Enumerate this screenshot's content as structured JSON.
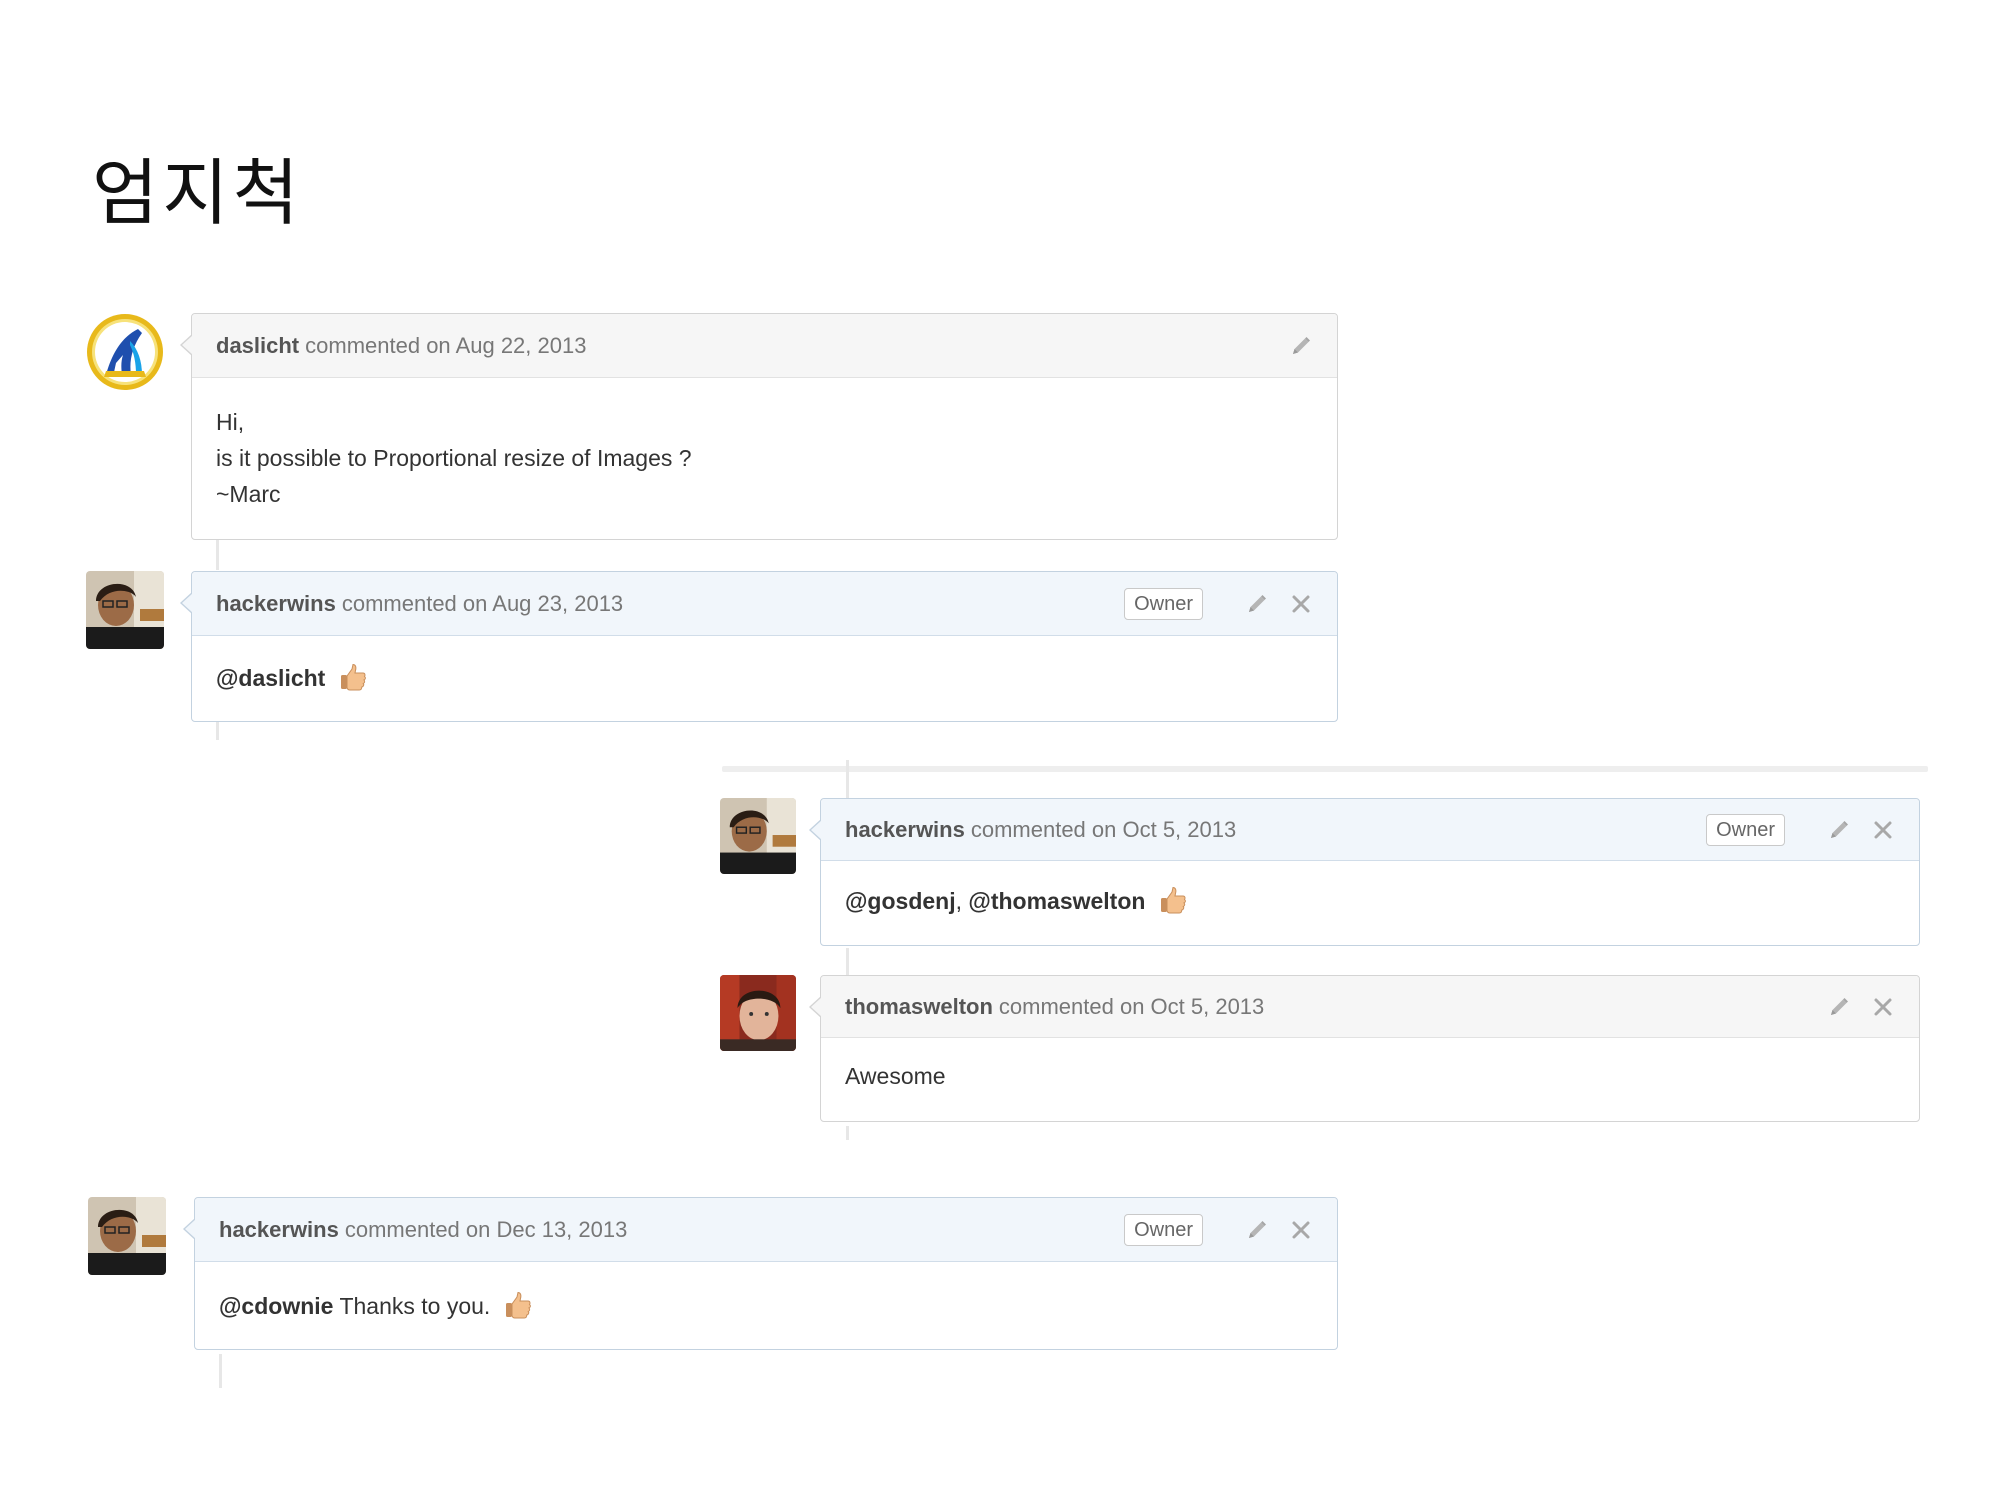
{
  "slide": {
    "title": "엄지척"
  },
  "comments": [
    {
      "author": "daslicht",
      "meta": "commented on Aug 22, 2013",
      "body_lines": [
        "Hi,",
        "is it possible to Proportional resize of Images ?",
        "~Marc"
      ]
    },
    {
      "author": "hackerwins",
      "meta": "commented on Aug 23, 2013",
      "badge": "Owner",
      "mention": "@daslicht"
    },
    {
      "author": "hackerwins",
      "meta": "commented on Oct 5, 2013",
      "badge": "Owner",
      "mention_a": "@gosdenj",
      "separator": ",",
      "mention_b": "@thomaswelton"
    },
    {
      "author": "thomaswelton",
      "meta": "commented on Oct 5, 2013",
      "body": "Awesome"
    },
    {
      "author": "hackerwins",
      "meta": "commented on Dec 13, 2013",
      "badge": "Owner",
      "mention": "@cdownie",
      "text": "Thanks to you."
    }
  ],
  "icons": {
    "edit": "pencil-icon",
    "delete": "close-icon",
    "reaction": "thumbs-up-icon"
  },
  "colors": {
    "owner_header_bg": "#f1f6fb",
    "header_bg": "#f6f6f6",
    "border": "#d4d4d4"
  }
}
